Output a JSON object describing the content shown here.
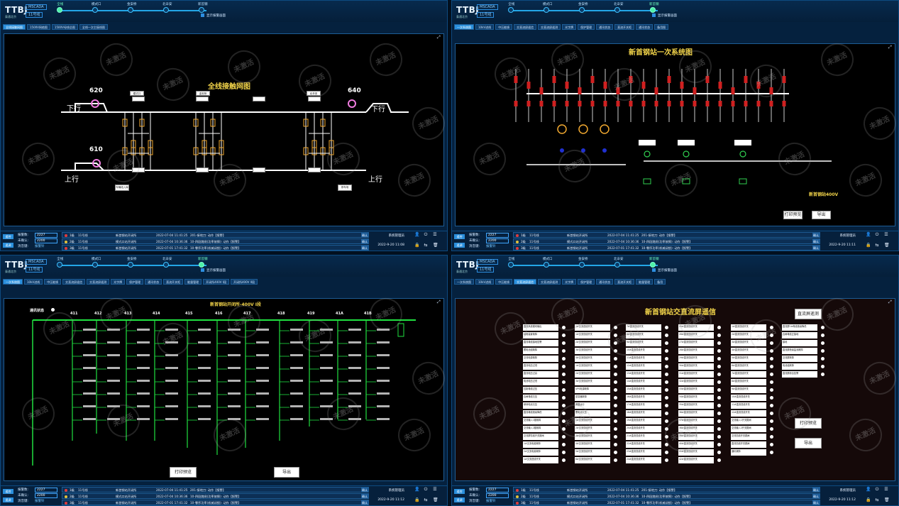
{
  "app": {
    "logo": "TTBJ",
    "logo_sub": "泰通北京",
    "brand": "MSCADA",
    "line": "11号线"
  },
  "stations": [
    "全线",
    "模式口",
    "金安桥",
    "北辛安",
    "新首钢"
  ],
  "active_station_index_tl": 0,
  "active_station_index_other": 4,
  "checkbox_label": "显示报警画面",
  "panels": {
    "tl": {
      "tabs": [
        "全线接触网图",
        "1500V网络图",
        "1500V母线总图",
        "全线一次主接线图"
      ],
      "title": "全线接触网图",
      "left_up_label": "上行",
      "left_down_label": "下行",
      "right_up_label": "上行",
      "right_down_label": "下行",
      "nodes": [
        "620",
        "640",
        "610"
      ],
      "stations": [
        "模式口",
        "金安桥",
        "北辛安"
      ],
      "bottom_boxes": [
        "车辆段入库",
        "停车场"
      ]
    },
    "tr": {
      "tabs": [
        "一次系统图",
        "10kV进线",
        "中压能馈",
        "交直流屏遥信",
        "交直流屏遥测",
        "光字牌",
        "保护管理",
        "通讯状态",
        "直流开关柜",
        "通讯状态",
        "备用图"
      ],
      "title": "新首钢站一次系统图",
      "subtitle": "新首钢站400V",
      "print_label": "打印预览",
      "export_label": "导出"
    },
    "bl": {
      "tabs": [
        "一次系统图",
        "10kV进线",
        "中压能馈",
        "交直流屏遥信",
        "交直流屏遥测",
        "光字牌",
        "保护管理",
        "通讯状态",
        "直流开关柜",
        "能量管理",
        "开闭所400V I段",
        "开闭所400V II段"
      ],
      "title": "新首钢站开闭所-400V I段",
      "comm_label": "通讯状态",
      "columns": [
        "411",
        "412",
        "413",
        "414",
        "415",
        "416",
        "417",
        "418",
        "419",
        "41A",
        "41B"
      ],
      "print_label": "打印预览",
      "export_label": "导出"
    },
    "br": {
      "tabs": [
        "一次系统图",
        "10kV进线",
        "中压能馈",
        "交直流屏遥信",
        "交直流屏遥测",
        "光字牌",
        "保护管理",
        "通讯状态",
        "直流开关柜",
        "能量管理",
        "备用"
      ],
      "title": "新首钢站交直流屏遥信",
      "top_btn": "直流屏遥测",
      "print_label": "打印预览",
      "export_label": "导出",
      "col1": [
        "直流系统模块输出",
        "硅堆装置故障",
        "直流母线接地告警",
        "蓄电池组故障",
        "交流电源故障",
        "直流电压过低",
        "直流电压过高",
        "电池电压过低",
        "控制母线过压",
        "合闸母线欠压",
        "单体电池欠压",
        "直流母线绝缘降低",
        "交流输入1路故障",
        "交流输入2路故障",
        "交流屏馈线开关跳闸",
        "1#交流电源故障",
        "2#交流电源故障",
        "1#交流进线开关"
      ],
      "col2": [
        "2#交流进线开关",
        "1#交流馈线开关",
        "2#交流馈线开关",
        "3#交流馈线开关",
        "4#交流馈线开关",
        "1#交流馈线开关",
        "2#交流馈线开关",
        "3#交流馈线开关",
        "UPS电源故障",
        "逆变器故障",
        "旁路运行",
        "蓄电池欠压",
        "1#交流馈线开关",
        "2#交流馈线开关",
        "3#交流馈线开关",
        "4#交流馈线开关",
        "5#交流馈线开关",
        "6#交流馈线开关"
      ],
      "col3": [
        "7#直流馈线开关",
        "8#直流馈线开关",
        "9#直流馈线开关",
        "10#直流馈线开关",
        "11#直流馈线开关",
        "12#直流馈线开关",
        "13#直流馈线开关",
        "14#直流馈线开关",
        "15#直流馈线开关",
        "16#直流馈线开关",
        "17#直流馈线开关",
        "18#直流馈线开关",
        "19#直流馈线开关",
        "20#直流馈线开关",
        "21#直流馈线开关",
        "22#直流馈线开关",
        "23#直流馈线开关",
        "24#直流馈线开关"
      ],
      "col4": [
        "25#直流馈线开关",
        "26#直流馈线开关",
        "27#直流馈线开关",
        "28#直流馈线开关",
        "29#直流馈线开关",
        "30#直流馈线开关",
        "31#直流馈线开关",
        "32#直流馈线开关",
        "33#直流馈线开关",
        "34#直流馈线开关",
        "35#直流馈线开关",
        "36#直流馈线开关",
        "37#直流馈线开关",
        "38#直流馈线开关",
        "39#直流馈线开关",
        "40#直流馈线开关",
        "41#直流馈线开关",
        "42#直流馈线开关"
      ],
      "col5": [
        "1#直流馈线开关",
        "2#直流馈线开关",
        "3#直流馈线开关",
        "4#直流馈线开关",
        "5#直流馈线开关",
        "6#直流馈线开关",
        "7#直流馈线开关",
        "8#直流馈线开关",
        "9#直流馈线开关",
        "10#直流馈线开关",
        "11#直流馈线开关",
        "12#直流馈线开关",
        "交流输入1开关跳闸",
        "交流输入2开关跳闸",
        "交流馈线开关跳闸",
        "直流馈线开关跳闸",
        "通讯故障"
      ],
      "col6": [
        "直流屏1#母线绝缘降低",
        "合闸母线正接地",
        "接地",
        "直流屏绝缘监测故障",
        "交流屏故障",
        "电池组故障",
        "直流屏综合告警"
      ]
    }
  },
  "footer": {
    "btn1": "遥控",
    "btn2": "遥调",
    "alarm_count_label": "报警数:",
    "alarm_count": "2227",
    "unconfirmed_label": "未确认:",
    "unconfirmed": "2200",
    "mute_label": "消音键:",
    "mute_value": "报警铃",
    "alarms": [
      {
        "idx": "1级",
        "line": "11号线",
        "station": "新首钢站开闭所",
        "time": "2022-07-04 11:41:25",
        "msg": "201-接地刀: 动作【报警】",
        "color": "#e23b3b"
      },
      {
        "idx": "2级",
        "line": "11号线",
        "station": "模式口站开闭所",
        "time": "2022-07-04 10:36:36",
        "msg": "10-四段跳闸(功率故障): 动作【报警】",
        "color": "#e2c23b"
      },
      {
        "idx": "3级",
        "line": "11号线",
        "station": "新首钢站开闭所",
        "time": "2022-07-01 17:41:32",
        "msg": "10-零序功率(机械闭锁): 动作【报警】",
        "color": "#e23b3b"
      }
    ],
    "ack": "确认",
    "user": "系统管理员",
    "times": [
      "2022-9-20 11:08",
      "2022-9-20 11:11",
      "2022-9-20 11:12",
      "2022-9-20 11:12"
    ]
  },
  "watermark": "未激活"
}
